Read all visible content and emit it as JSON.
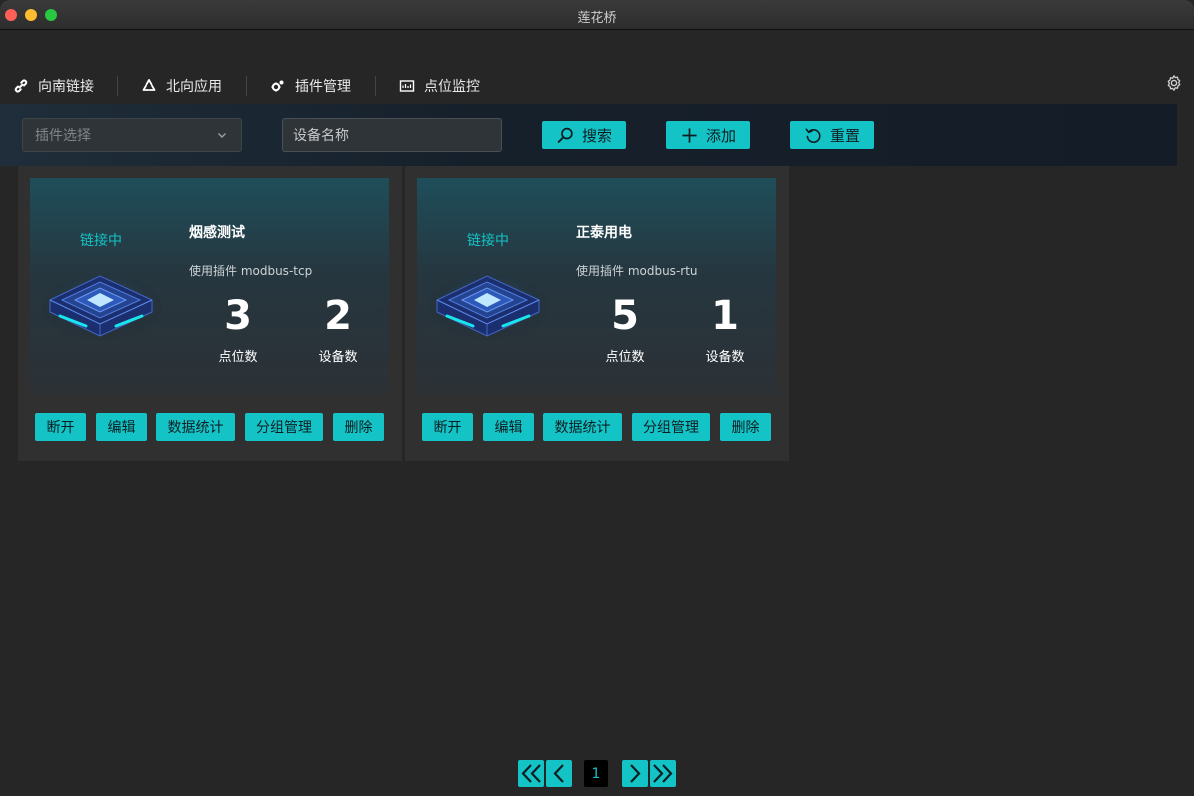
{
  "window": {
    "title": "莲花桥"
  },
  "tabs": [
    {
      "label": "向南链接",
      "icon": "link-icon",
      "active": true
    },
    {
      "label": "北向应用",
      "icon": "recycle-icon",
      "active": false
    },
    {
      "label": "插件管理",
      "icon": "plugin-gear-icon",
      "active": false
    },
    {
      "label": "点位监控",
      "icon": "monitor-icon",
      "active": false
    }
  ],
  "filters": {
    "plugin_select_placeholder": "插件选择",
    "device_name_placeholder": "设备名称",
    "search_label": "搜索",
    "add_label": "添加",
    "reset_label": "重置"
  },
  "cards": [
    {
      "status": "链接中",
      "name": "烟感测试",
      "plugin_text": "使用插件 modbus-tcp",
      "points": "3",
      "points_label": "点位数",
      "devices": "2",
      "devices_label": "设备数",
      "buttons": [
        "断开",
        "编辑",
        "数据统计",
        "分组管理",
        "删除"
      ]
    },
    {
      "status": "链接中",
      "name": "正泰用电",
      "plugin_text": "使用插件 modbus-rtu",
      "points": "5",
      "points_label": "点位数",
      "devices": "1",
      "devices_label": "设备数",
      "buttons": [
        "断开",
        "编辑",
        "数据统计",
        "分组管理",
        "删除"
      ]
    }
  ],
  "pagination": {
    "current_page": "1"
  },
  "colors": {
    "accent": "#14c3c6",
    "background": "#262626",
    "card": "#303030"
  }
}
